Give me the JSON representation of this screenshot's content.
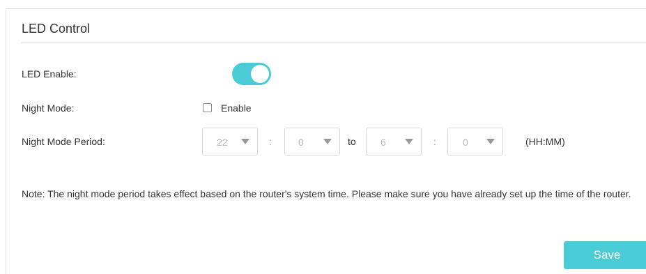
{
  "section": {
    "title": "LED Control"
  },
  "led_enable": {
    "label": "LED Enable:",
    "enabled": true
  },
  "night_mode": {
    "label": "Night Mode:",
    "checkbox_label": "Enable",
    "checked": false
  },
  "night_mode_period": {
    "label": "Night Mode Period:",
    "start_hour": "22",
    "start_minute": "0",
    "end_hour": "6",
    "end_minute": "0",
    "colon": ":",
    "to_label": "to",
    "format_hint": "(HH:MM)"
  },
  "note": "Note: The night mode period takes effect based on the router's system time. Please make sure you have already set up the time of the router.",
  "save_button": "Save",
  "colors": {
    "accent": "#4acbd6"
  }
}
